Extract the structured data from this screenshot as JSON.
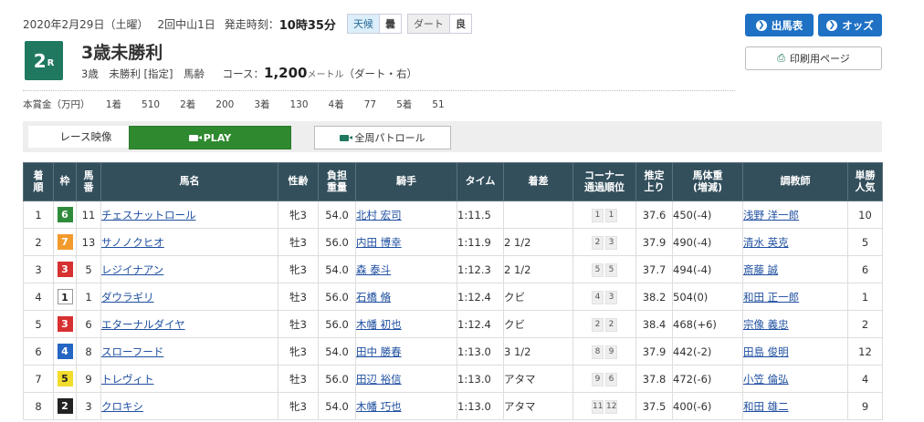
{
  "header": {
    "date": "2020年2月29日（土曜）",
    "meeting": "2回中山1日",
    "post_time_label": "発走時刻：",
    "post_time": "10時35分",
    "weather_label": "天候",
    "weather": "曇",
    "track_label": "ダート",
    "track_condition": "良"
  },
  "race": {
    "number": "2",
    "suffix": "R",
    "title": "3歳未勝利",
    "subtitle": "3歳　未勝利 [指定]　馬齢",
    "course_label": "コース：",
    "distance": "1,200",
    "unit": "メートル",
    "surface": "（ダート・右）"
  },
  "prize": {
    "label": "本賞金（万円）",
    "items": [
      {
        "place": "1着",
        "amount": "510"
      },
      {
        "place": "2着",
        "amount": "200"
      },
      {
        "place": "3着",
        "amount": "130"
      },
      {
        "place": "4着",
        "amount": "77"
      },
      {
        "place": "5着",
        "amount": "51"
      }
    ]
  },
  "buttons": {
    "entries": "出馬表",
    "odds": "オッズ",
    "print": "印刷用ページ",
    "race_video": "レース映像",
    "play": "PLAY",
    "patrol": "全周パトロール"
  },
  "table": {
    "headers": [
      "着順",
      "枠",
      "馬番",
      "馬名",
      "性齢",
      "負担重量",
      "騎手",
      "タイム",
      "着差",
      "コーナー通過順位",
      "推定上り",
      "馬体重(増減)",
      "調教師",
      "単勝人気"
    ],
    "rows": [
      {
        "rank": "1",
        "waku": "6",
        "num": "11",
        "horse": "チェスナットロール",
        "sex_age": "牝3",
        "weight": "54.0",
        "jockey": "北村 宏司",
        "time": "1:11.5",
        "margin": "",
        "corner": [
          "1",
          "1"
        ],
        "last3f": "37.6",
        "body": "450",
        "diff": "(-4)",
        "trainer": "浅野 洋一郎",
        "pop": "10"
      },
      {
        "rank": "2",
        "waku": "7",
        "num": "13",
        "horse": "サノノクヒオ",
        "sex_age": "牡3",
        "weight": "56.0",
        "jockey": "内田 博幸",
        "time": "1:11.9",
        "margin": "2 1/2",
        "corner": [
          "2",
          "3"
        ],
        "last3f": "37.9",
        "body": "490",
        "diff": "(-4)",
        "trainer": "清水 英克",
        "pop": "5"
      },
      {
        "rank": "3",
        "waku": "3",
        "num": "5",
        "horse": "レジイナアン",
        "sex_age": "牝3",
        "weight": "54.0",
        "jockey": "森 泰斗",
        "time": "1:12.3",
        "margin": "2 1/2",
        "corner": [
          "5",
          "5"
        ],
        "last3f": "37.7",
        "body": "494",
        "diff": "(-4)",
        "trainer": "斎藤 誠",
        "pop": "6"
      },
      {
        "rank": "4",
        "waku": "1",
        "num": "1",
        "horse": "ダウラギリ",
        "sex_age": "牡3",
        "weight": "56.0",
        "jockey": "石橋 脩",
        "time": "1:12.4",
        "margin": "クビ",
        "corner": [
          "4",
          "3"
        ],
        "last3f": "38.2",
        "body": "504",
        "diff": "(0)",
        "trainer": "和田 正一郎",
        "pop": "1"
      },
      {
        "rank": "5",
        "waku": "3",
        "num": "6",
        "horse": "エターナルダイヤ",
        "sex_age": "牡3",
        "weight": "56.0",
        "jockey": "木幡 初也",
        "time": "1:12.4",
        "margin": "クビ",
        "corner": [
          "2",
          "2"
        ],
        "last3f": "38.4",
        "body": "468",
        "diff": "(+6)",
        "trainer": "宗像 義忠",
        "pop": "2"
      },
      {
        "rank": "6",
        "waku": "4",
        "num": "8",
        "horse": "スローフード",
        "sex_age": "牝3",
        "weight": "54.0",
        "jockey": "田中 勝春",
        "time": "1:13.0",
        "margin": "3 1/2",
        "corner": [
          "8",
          "9"
        ],
        "last3f": "37.9",
        "body": "442",
        "diff": "(-2)",
        "trainer": "田島 俊明",
        "pop": "12"
      },
      {
        "rank": "7",
        "waku": "5",
        "num": "9",
        "horse": "トレヴィト",
        "sex_age": "牡3",
        "weight": "56.0",
        "jockey": "田辺 裕信",
        "time": "1:13.0",
        "margin": "アタマ",
        "corner": [
          "9",
          "6"
        ],
        "last3f": "37.8",
        "body": "472",
        "diff": "(-6)",
        "trainer": "小笠 倫弘",
        "pop": "4"
      },
      {
        "rank": "8",
        "waku": "2",
        "num": "3",
        "horse": "クロキシ",
        "sex_age": "牝3",
        "weight": "54.0",
        "jockey": "木幡 巧也",
        "time": "1:13.0",
        "margin": "アタマ",
        "corner": [
          "11",
          "12"
        ],
        "last3f": "37.5",
        "body": "400",
        "diff": "(-6)",
        "trainer": "和田 雄二",
        "pop": "9"
      }
    ]
  },
  "colors": {
    "waku": {
      "1": "#ffffff",
      "2": "#222222",
      "3": "#d63030",
      "4": "#2565c4",
      "5": "#f2dc2c",
      "6": "#2e8b3a",
      "7": "#f29a2c",
      "8": "#f29ab0"
    },
    "waku_text": {
      "1": "#222222",
      "2": "#ffffff",
      "3": "#ffffff",
      "4": "#ffffff",
      "5": "#222222",
      "6": "#ffffff",
      "7": "#ffffff",
      "8": "#ffffff"
    },
    "badge": "#207860",
    "header_bg": "#334f5c",
    "button_blue": "#1f71c4",
    "play_green": "#2f8a2f"
  },
  "icons": {
    "entries": "arrow-circle-icon",
    "odds": "arrow-circle-icon",
    "print": "printer-icon",
    "play": "video-camera-icon",
    "patrol": "video-camera-icon"
  }
}
